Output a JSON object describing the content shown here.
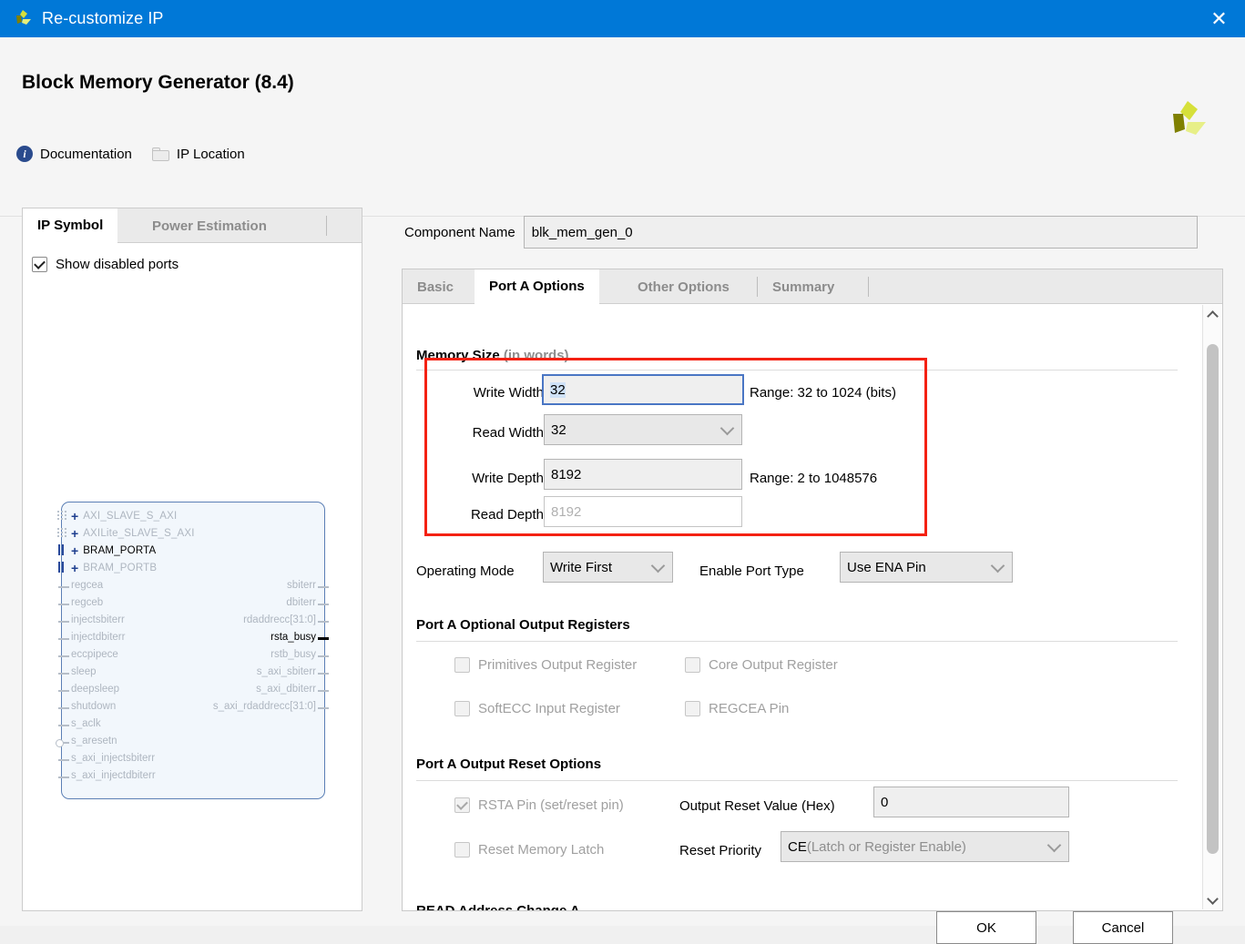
{
  "window": {
    "title": "Re-customize IP",
    "close_label": "✕",
    "logo_name": "xilinx-logo"
  },
  "header": {
    "ip_title": "Block Memory Generator (8.4)",
    "links": [
      {
        "label": "Documentation",
        "icon": "info-icon"
      },
      {
        "label": "IP Location",
        "icon": "folder-icon"
      }
    ]
  },
  "left_panel": {
    "tabs": [
      {
        "label": "IP Symbol",
        "active": true
      },
      {
        "label": "Power Estimation",
        "active": false
      }
    ],
    "show_disabled_ports": {
      "label": "Show disabled ports",
      "checked": true
    },
    "symbol": {
      "buses": [
        {
          "name": "AXI_SLAVE_S_AXI",
          "enabled": false,
          "marker": "dots"
        },
        {
          "name": "AXILite_SLAVE_S_AXI",
          "enabled": false,
          "marker": "dots"
        },
        {
          "name": "BRAM_PORTA",
          "enabled": true,
          "marker": "bars"
        },
        {
          "name": "BRAM_PORTB",
          "enabled": false,
          "marker": "bars"
        }
      ],
      "inputs": [
        {
          "name": "regcea",
          "enabled": false,
          "marker": "stub"
        },
        {
          "name": "regceb",
          "enabled": false,
          "marker": "stub"
        },
        {
          "name": "injectsbiterr",
          "enabled": false,
          "marker": "stub"
        },
        {
          "name": "injectdbiterr",
          "enabled": false,
          "marker": "stub"
        },
        {
          "name": "eccpipece",
          "enabled": false,
          "marker": "stub"
        },
        {
          "name": "sleep",
          "enabled": false,
          "marker": "stub"
        },
        {
          "name": "deepsleep",
          "enabled": false,
          "marker": "stub"
        },
        {
          "name": "shutdown",
          "enabled": false,
          "marker": "stub"
        },
        {
          "name": "s_aclk",
          "enabled": false,
          "marker": "stub"
        },
        {
          "name": "s_aresetn",
          "enabled": false,
          "marker": "bubble"
        },
        {
          "name": "s_axi_injectsbiterr",
          "enabled": false,
          "marker": "stub"
        },
        {
          "name": "s_axi_injectdbiterr",
          "enabled": false,
          "marker": "stub"
        }
      ],
      "outputs": [
        {
          "name": "sbiterr",
          "enabled": false
        },
        {
          "name": "dbiterr",
          "enabled": false
        },
        {
          "name": "rdaddrecc[31:0]",
          "enabled": false
        },
        {
          "name": "rsta_busy",
          "enabled": true
        },
        {
          "name": "rstb_busy",
          "enabled": false
        },
        {
          "name": "s_axi_sbiterr",
          "enabled": false
        },
        {
          "name": "s_axi_dbiterr",
          "enabled": false
        },
        {
          "name": "s_axi_rdaddrecc[31:0]",
          "enabled": false
        }
      ]
    }
  },
  "right_panel": {
    "component_name": {
      "label": "Component Name",
      "value": "blk_mem_gen_0"
    },
    "tabs": [
      {
        "label": "Basic",
        "active": false
      },
      {
        "label": "Port A Options",
        "active": true
      },
      {
        "label": "Other Options",
        "active": false
      },
      {
        "label": "Summary",
        "active": false
      }
    ],
    "memory_size": {
      "title": "Memory Size",
      "title_suffix": " (in words)",
      "write_width": {
        "label": "Write Width",
        "value": "32",
        "range": "Range: 32 to 1024 (bits)"
      },
      "read_width": {
        "label": "Read Width",
        "value": "32"
      },
      "write_depth": {
        "label": "Write Depth",
        "value": "8192",
        "range": "Range: 2 to 1048576"
      },
      "read_depth": {
        "label": "Read Depth",
        "value": "8192"
      }
    },
    "operating_mode": {
      "label": "Operating Mode",
      "value": "Write First"
    },
    "enable_port_type": {
      "label": "Enable Port Type",
      "value": "Use ENA Pin"
    },
    "optional_output_registers": {
      "title": "Port A Optional Output Registers",
      "checkboxes": [
        {
          "label": "Primitives Output Register",
          "checked": false,
          "disabled": true
        },
        {
          "label": "Core Output Register",
          "checked": false,
          "disabled": true
        },
        {
          "label": "SoftECC Input Register",
          "checked": false,
          "disabled": true
        },
        {
          "label": "REGCEA Pin",
          "checked": false,
          "disabled": true
        }
      ]
    },
    "output_reset_options": {
      "title": "Port A Output Reset Options",
      "rsta_pin": {
        "label": "RSTA Pin (set/reset pin)",
        "checked": true,
        "disabled": true
      },
      "reset_memory_latch": {
        "label": "Reset Memory Latch",
        "checked": false,
        "disabled": true
      },
      "output_reset_value": {
        "label": "Output Reset Value (Hex)",
        "value": "0"
      },
      "reset_priority": {
        "label": "Reset Priority",
        "value": "CE",
        "value_suffix": " (Latch or Register Enable)"
      }
    },
    "clipped_section_title": "READ Address Change A"
  },
  "footer": {
    "ok_label": "OK",
    "cancel_label": "Cancel"
  },
  "colors": {
    "titlebar": "#0078d7",
    "accent_red": "#f42113",
    "focus_blue": "#4a76c4",
    "selection_blue": "#cfe2f7"
  }
}
